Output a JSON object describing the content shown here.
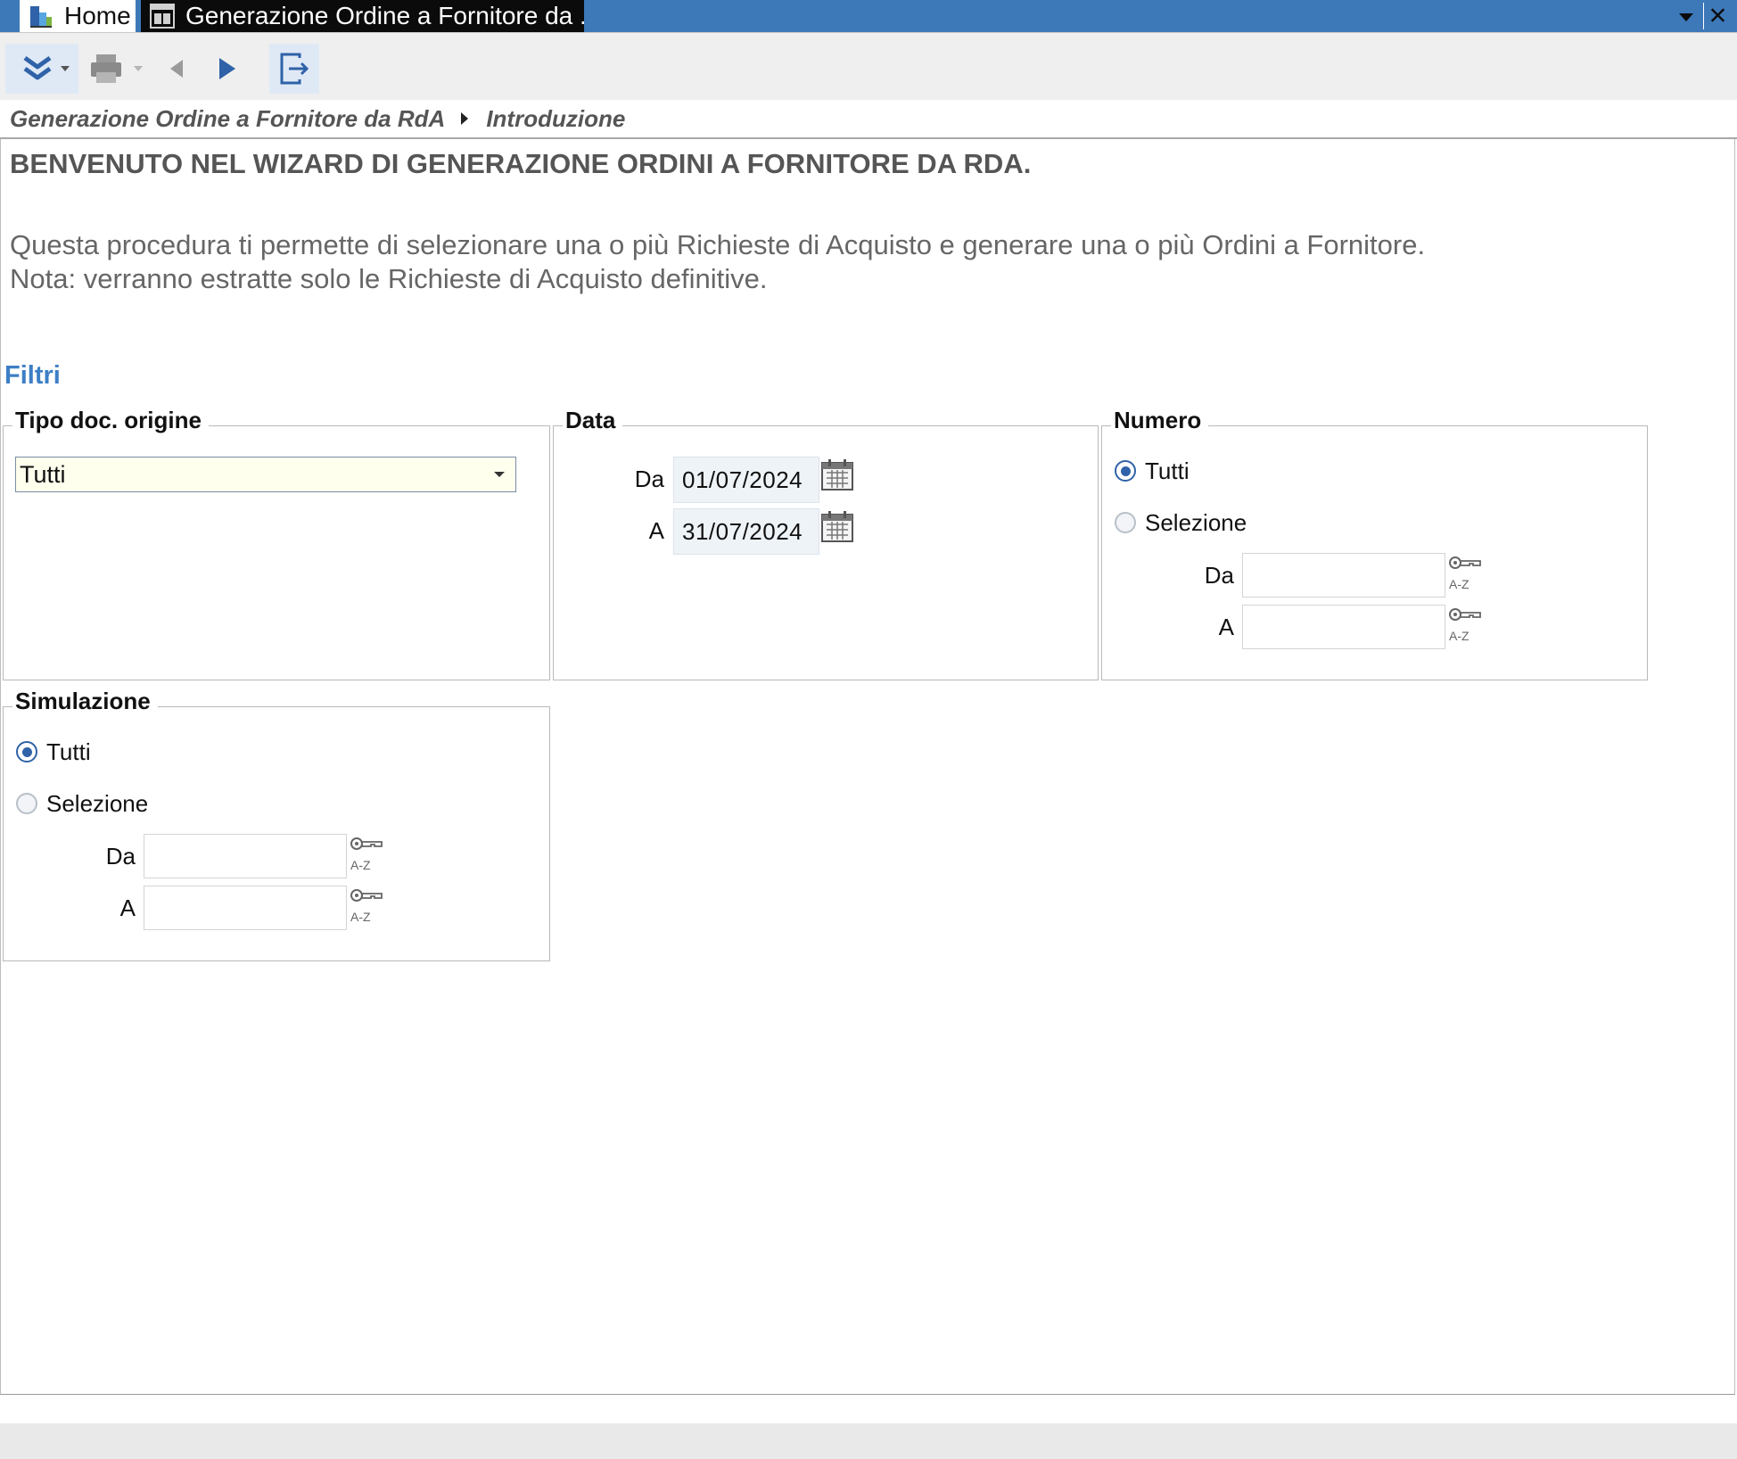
{
  "tabs": [
    {
      "label": "Home",
      "icon": "app-logo-icon"
    },
    {
      "label": "Generazione Ordine a Fornitore da ...",
      "icon": "form-window-icon"
    }
  ],
  "toolbar": {
    "buttons": [
      "collapse-icon",
      "print-icon",
      "back-arrow-icon",
      "next-arrow-icon",
      "exit-icon"
    ]
  },
  "breadcrumb": {
    "wizard": "Generazione Ordine a Fornitore da RdA",
    "step": "Introduzione"
  },
  "intro": {
    "title": "BENVENUTO NEL WIZARD DI GENERAZIONE ORDINI A FORNITORE DA RDA.",
    "line1": "Questa procedura ti permette di selezionare una o più Richieste di Acquisto e generare una o più Ordini a Fornitore.",
    "line2": "Nota: verranno estratte solo le Richieste di Acquisto definitive."
  },
  "filters": {
    "title": "Filtri",
    "tipo": {
      "legend": "Tipo doc. origine",
      "value": "Tutti"
    },
    "data": {
      "legend": "Data",
      "from_label": "Da",
      "from_value": "01/07/2024",
      "to_label": "A",
      "to_value": "31/07/2024"
    },
    "numero": {
      "legend": "Numero",
      "option_all": "Tutti",
      "option_select": "Selezione",
      "selected": "Tutti",
      "from_label": "Da",
      "to_label": "A",
      "from_value": "",
      "to_value": ""
    },
    "simulazione": {
      "legend": "Simulazione",
      "option_all": "Tutti",
      "option_select": "Selezione",
      "selected": "Tutti",
      "from_label": "Da",
      "to_label": "A",
      "from_value": "",
      "to_value": ""
    }
  },
  "colors": {
    "tab_bar": "#3d78b8",
    "accent": "#3d7fc6",
    "field_highlight": "#ffffee",
    "radio_selected": "#2f62a8"
  }
}
